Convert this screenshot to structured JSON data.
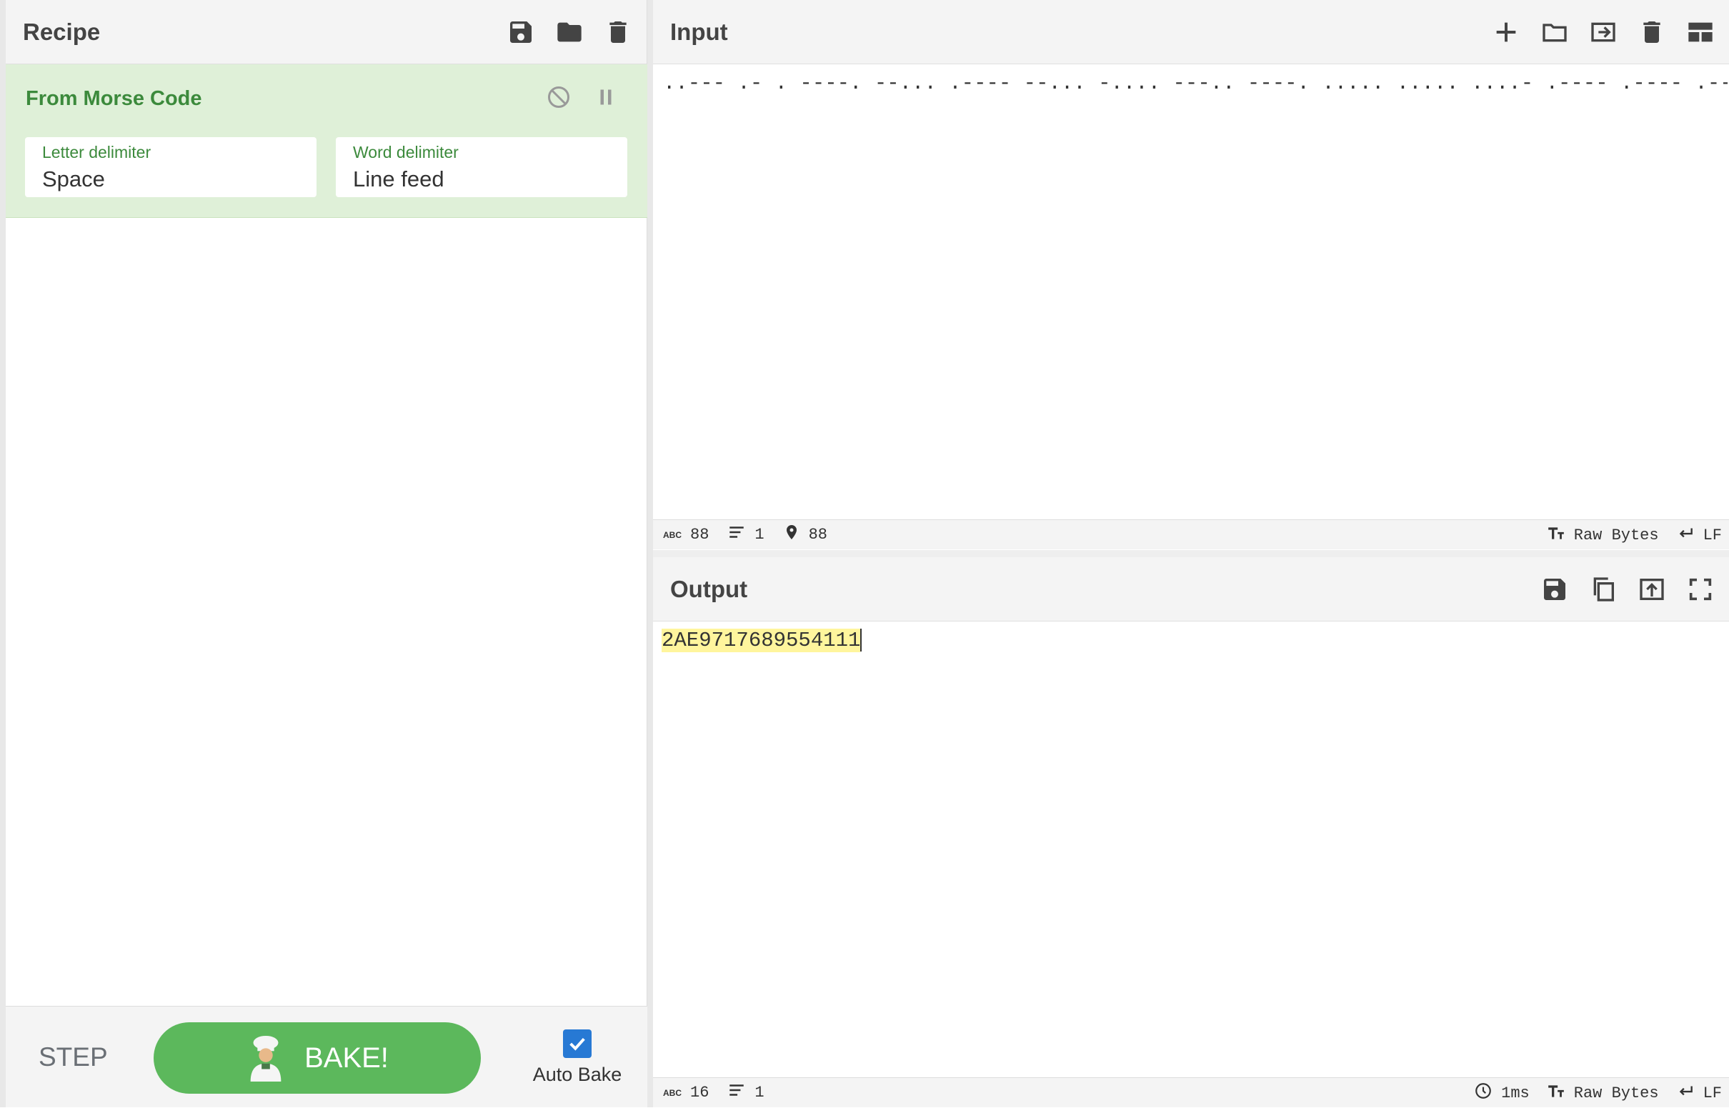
{
  "recipe": {
    "title": "Recipe",
    "header_icons": [
      "save-icon",
      "folder-icon",
      "trash-icon"
    ],
    "operation": {
      "name": "From Morse Code",
      "icons": [
        "disable-icon",
        "pause-icon"
      ],
      "letter_delimiter_label": "Letter delimiter",
      "letter_delimiter_value": "Space",
      "word_delimiter_label": "Word delimiter",
      "word_delimiter_value": "Line feed"
    },
    "footer": {
      "step_label": "STEP",
      "bake_label": "BAKE!",
      "auto_bake_label": "Auto Bake",
      "auto_bake_checked": true
    }
  },
  "input": {
    "title": "Input",
    "header_icons": [
      "plus-icon",
      "folder-icon",
      "import-icon",
      "trash-icon",
      "layout-icon"
    ],
    "text": "..--- .- . ----. --... .---- --... -.... ---.. ----. ..... ..... ....- .---- .---- .----",
    "status": {
      "length": "88",
      "lines": "1",
      "position": "88",
      "encoding": "Raw Bytes",
      "eol": "LF"
    }
  },
  "output": {
    "title": "Output",
    "header_icons": [
      "save-icon",
      "copy-icon",
      "replace-input-icon",
      "fullscreen-icon"
    ],
    "text": "2AE9717689554111",
    "status": {
      "length": "16",
      "lines": "1",
      "time": "1ms",
      "encoding": "Raw Bytes",
      "eol": "LF"
    }
  },
  "colors": {
    "operation_bg": "#dff0d8",
    "operation_text": "#3c8a3c",
    "bake_button": "#5cb85c",
    "checkbox": "#2779d4",
    "highlight": "#fff59d"
  }
}
